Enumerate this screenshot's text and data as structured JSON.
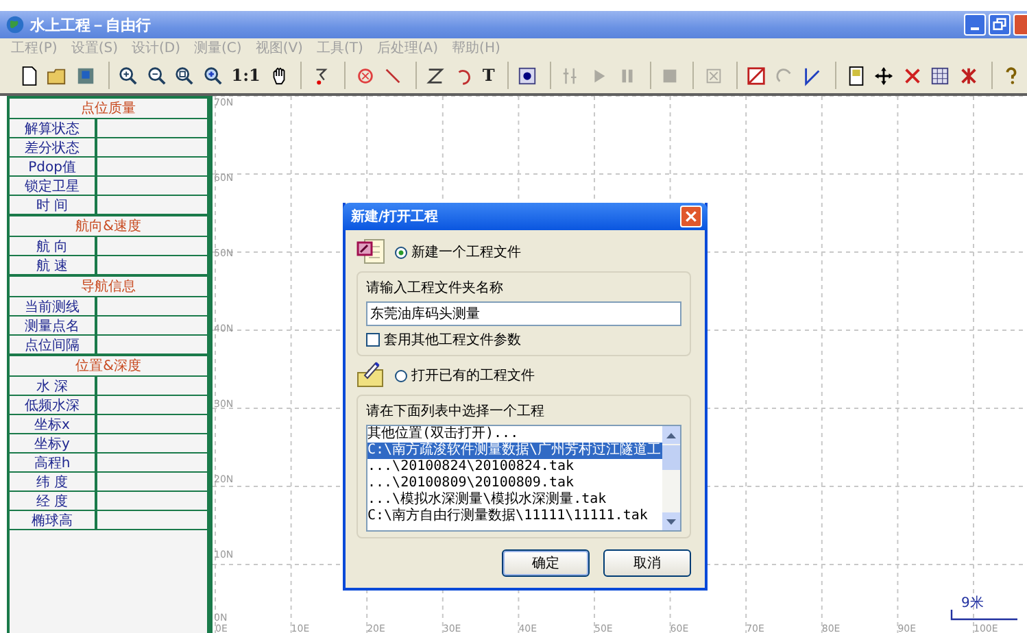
{
  "window": {
    "title": "水上工程－自由行"
  },
  "menu": [
    {
      "label": "工程(P)",
      "disabled": true
    },
    {
      "label": "设置(S)",
      "disabled": true
    },
    {
      "label": "设计(D)",
      "disabled": true
    },
    {
      "label": "测量(C)",
      "disabled": true
    },
    {
      "label": "视图(V)",
      "disabled": true
    },
    {
      "label": "工具(T)",
      "disabled": true
    },
    {
      "label": "后处理(A)",
      "disabled": true
    },
    {
      "label": "帮助(H)",
      "disabled": true
    }
  ],
  "toolbar": [
    [
      {
        "kind": "icon",
        "disabled": false
      },
      {
        "kind": "icon",
        "disabled": false
      },
      {
        "kind": "icon",
        "disabled": false
      }
    ],
    [
      {
        "kind": "icon",
        "disabled": false
      },
      {
        "kind": "icon",
        "disabled": false
      },
      {
        "kind": "icon",
        "disabled": false
      },
      {
        "kind": "icon",
        "disabled": false
      },
      {
        "kind": "text",
        "label": "1:1",
        "disabled": false
      },
      {
        "kind": "icon",
        "disabled": false
      }
    ],
    [
      {
        "kind": "icon",
        "disabled": false
      }
    ],
    [
      {
        "kind": "icon",
        "disabled": false
      },
      {
        "kind": "icon",
        "disabled": false
      }
    ],
    [
      {
        "kind": "icon",
        "disabled": false
      },
      {
        "kind": "icon",
        "disabled": false
      },
      {
        "kind": "text",
        "label": "T",
        "disabled": false
      }
    ],
    [
      {
        "kind": "icon",
        "disabled": false
      }
    ],
    [
      {
        "kind": "icon",
        "disabled": true
      },
      {
        "kind": "icon",
        "disabled": true
      },
      {
        "kind": "icon",
        "disabled": true
      }
    ],
    [
      {
        "kind": "icon",
        "disabled": true
      }
    ],
    [
      {
        "kind": "icon",
        "disabled": true
      }
    ],
    [
      {
        "kind": "icon",
        "disabled": false
      },
      {
        "kind": "icon",
        "disabled": true
      },
      {
        "kind": "icon",
        "disabled": false
      }
    ],
    [
      {
        "kind": "icon",
        "disabled": false
      },
      {
        "kind": "icon",
        "disabled": false
      },
      {
        "kind": "icon",
        "disabled": false
      },
      {
        "kind": "icon",
        "disabled": false
      },
      {
        "kind": "icon",
        "disabled": false
      }
    ],
    [
      {
        "kind": "icon",
        "disabled": false
      }
    ]
  ],
  "status_panel": [
    {
      "title": "点位质量",
      "rows": [
        "解算状态",
        "差分状态",
        "Pdop值",
        "锁定卫星",
        "时 间"
      ]
    },
    {
      "title": "航向&速度",
      "rows": [
        "航 向",
        "航 速"
      ]
    },
    {
      "title": "导航信息",
      "rows": [
        "当前测线",
        "测量点名",
        "点位间隔"
      ]
    },
    {
      "title": "位置&深度",
      "rows": [
        "水 深",
        "低频水深",
        "坐标x",
        "坐标y",
        "高程h",
        "纬 度",
        "经 度",
        "椭球高"
      ]
    }
  ],
  "map": {
    "y_labels": [
      "70N",
      "60N",
      "50N",
      "40N",
      "30N",
      "20N",
      "10N",
      "0N"
    ],
    "x_labels": [
      "0E",
      "10E",
      "20E",
      "30E",
      "40E",
      "50E",
      "60E",
      "70E",
      "80E",
      "90E",
      "100E"
    ],
    "scale": "9米"
  },
  "dialog": {
    "title": "新建/打开工程",
    "new_option": {
      "label": "新建一个工程文件",
      "selected": true
    },
    "folder_prompt": "请输入工程文件夹名称",
    "folder_name": "东莞油库码头测量",
    "reuse_params": {
      "label": "套用其他工程文件参数",
      "checked": false
    },
    "open_option": {
      "label": "打开已有的工程文件",
      "selected": false
    },
    "list_prompt": "请在下面列表中选择一个工程",
    "projects": [
      {
        "label": "其他位置(双击打开)...",
        "selected": false
      },
      {
        "label": "C:\\南方疏浚软件测量数据\\广州芳村过江隧道工",
        "selected": true
      },
      {
        "label": "...\\20100824\\20100824.tak",
        "selected": false
      },
      {
        "label": "...\\20100809\\20100809.tak",
        "selected": false
      },
      {
        "label": "...\\模拟水深测量\\模拟水深测量.tak",
        "selected": false
      },
      {
        "label": "C:\\南方自由行测量数据\\11111\\11111.tak",
        "selected": false
      }
    ],
    "buttons": [
      "确定",
      "取消"
    ]
  }
}
